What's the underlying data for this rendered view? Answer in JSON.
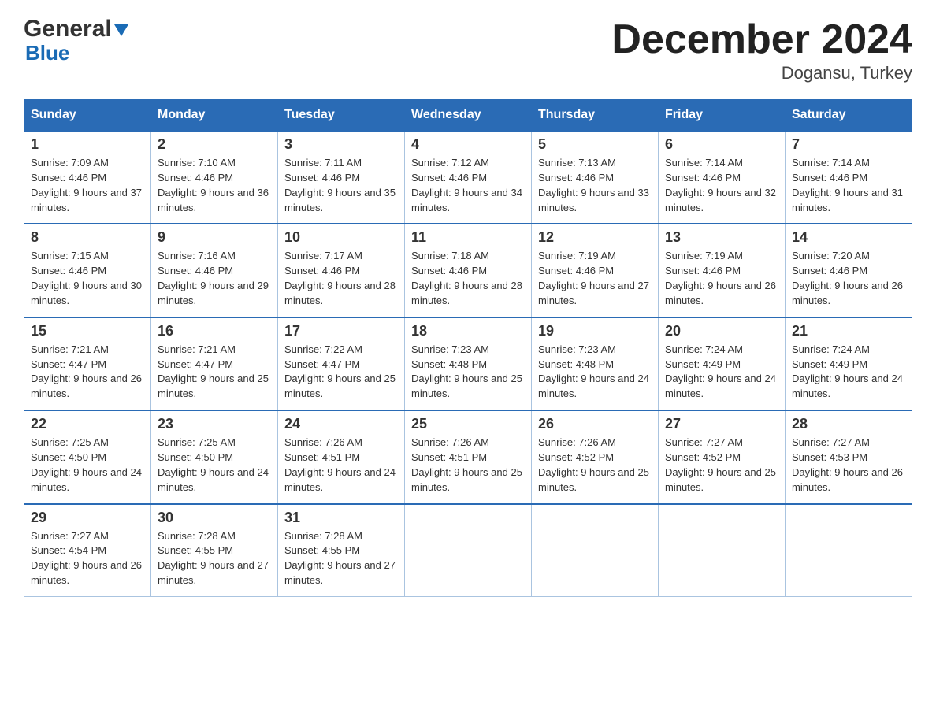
{
  "header": {
    "logo_general": "General",
    "logo_blue": "Blue",
    "title": "December 2024",
    "subtitle": "Dogansu, Turkey"
  },
  "days_of_week": [
    "Sunday",
    "Monday",
    "Tuesday",
    "Wednesday",
    "Thursday",
    "Friday",
    "Saturday"
  ],
  "weeks": [
    [
      {
        "num": "1",
        "sunrise": "7:09 AM",
        "sunset": "4:46 PM",
        "daylight": "9 hours and 37 minutes."
      },
      {
        "num": "2",
        "sunrise": "7:10 AM",
        "sunset": "4:46 PM",
        "daylight": "9 hours and 36 minutes."
      },
      {
        "num": "3",
        "sunrise": "7:11 AM",
        "sunset": "4:46 PM",
        "daylight": "9 hours and 35 minutes."
      },
      {
        "num": "4",
        "sunrise": "7:12 AM",
        "sunset": "4:46 PM",
        "daylight": "9 hours and 34 minutes."
      },
      {
        "num": "5",
        "sunrise": "7:13 AM",
        "sunset": "4:46 PM",
        "daylight": "9 hours and 33 minutes."
      },
      {
        "num": "6",
        "sunrise": "7:14 AM",
        "sunset": "4:46 PM",
        "daylight": "9 hours and 32 minutes."
      },
      {
        "num": "7",
        "sunrise": "7:14 AM",
        "sunset": "4:46 PM",
        "daylight": "9 hours and 31 minutes."
      }
    ],
    [
      {
        "num": "8",
        "sunrise": "7:15 AM",
        "sunset": "4:46 PM",
        "daylight": "9 hours and 30 minutes."
      },
      {
        "num": "9",
        "sunrise": "7:16 AM",
        "sunset": "4:46 PM",
        "daylight": "9 hours and 29 minutes."
      },
      {
        "num": "10",
        "sunrise": "7:17 AM",
        "sunset": "4:46 PM",
        "daylight": "9 hours and 28 minutes."
      },
      {
        "num": "11",
        "sunrise": "7:18 AM",
        "sunset": "4:46 PM",
        "daylight": "9 hours and 28 minutes."
      },
      {
        "num": "12",
        "sunrise": "7:19 AM",
        "sunset": "4:46 PM",
        "daylight": "9 hours and 27 minutes."
      },
      {
        "num": "13",
        "sunrise": "7:19 AM",
        "sunset": "4:46 PM",
        "daylight": "9 hours and 26 minutes."
      },
      {
        "num": "14",
        "sunrise": "7:20 AM",
        "sunset": "4:46 PM",
        "daylight": "9 hours and 26 minutes."
      }
    ],
    [
      {
        "num": "15",
        "sunrise": "7:21 AM",
        "sunset": "4:47 PM",
        "daylight": "9 hours and 26 minutes."
      },
      {
        "num": "16",
        "sunrise": "7:21 AM",
        "sunset": "4:47 PM",
        "daylight": "9 hours and 25 minutes."
      },
      {
        "num": "17",
        "sunrise": "7:22 AM",
        "sunset": "4:47 PM",
        "daylight": "9 hours and 25 minutes."
      },
      {
        "num": "18",
        "sunrise": "7:23 AM",
        "sunset": "4:48 PM",
        "daylight": "9 hours and 25 minutes."
      },
      {
        "num": "19",
        "sunrise": "7:23 AM",
        "sunset": "4:48 PM",
        "daylight": "9 hours and 24 minutes."
      },
      {
        "num": "20",
        "sunrise": "7:24 AM",
        "sunset": "4:49 PM",
        "daylight": "9 hours and 24 minutes."
      },
      {
        "num": "21",
        "sunrise": "7:24 AM",
        "sunset": "4:49 PM",
        "daylight": "9 hours and 24 minutes."
      }
    ],
    [
      {
        "num": "22",
        "sunrise": "7:25 AM",
        "sunset": "4:50 PM",
        "daylight": "9 hours and 24 minutes."
      },
      {
        "num": "23",
        "sunrise": "7:25 AM",
        "sunset": "4:50 PM",
        "daylight": "9 hours and 24 minutes."
      },
      {
        "num": "24",
        "sunrise": "7:26 AM",
        "sunset": "4:51 PM",
        "daylight": "9 hours and 24 minutes."
      },
      {
        "num": "25",
        "sunrise": "7:26 AM",
        "sunset": "4:51 PM",
        "daylight": "9 hours and 25 minutes."
      },
      {
        "num": "26",
        "sunrise": "7:26 AM",
        "sunset": "4:52 PM",
        "daylight": "9 hours and 25 minutes."
      },
      {
        "num": "27",
        "sunrise": "7:27 AM",
        "sunset": "4:52 PM",
        "daylight": "9 hours and 25 minutes."
      },
      {
        "num": "28",
        "sunrise": "7:27 AM",
        "sunset": "4:53 PM",
        "daylight": "9 hours and 26 minutes."
      }
    ],
    [
      {
        "num": "29",
        "sunrise": "7:27 AM",
        "sunset": "4:54 PM",
        "daylight": "9 hours and 26 minutes."
      },
      {
        "num": "30",
        "sunrise": "7:28 AM",
        "sunset": "4:55 PM",
        "daylight": "9 hours and 27 minutes."
      },
      {
        "num": "31",
        "sunrise": "7:28 AM",
        "sunset": "4:55 PM",
        "daylight": "9 hours and 27 minutes."
      },
      null,
      null,
      null,
      null
    ]
  ],
  "labels": {
    "sunrise": "Sunrise:",
    "sunset": "Sunset:",
    "daylight": "Daylight:"
  }
}
